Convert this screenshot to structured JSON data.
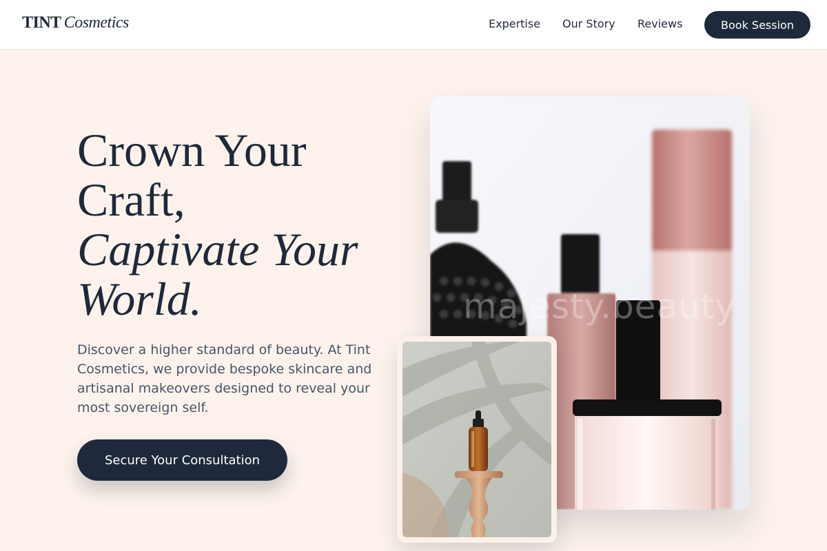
{
  "brand": {
    "name": "TINT",
    "sub": "Cosmetics"
  },
  "nav": {
    "links": [
      "Expertise",
      "Our Story",
      "Reviews"
    ],
    "cta": "Book Session"
  },
  "hero": {
    "title_line1": "Crown Your",
    "title_line2": "Craft,",
    "title_line3": "Captivate Your",
    "title_line4": "World.",
    "description": "Discover a higher standard of beauty. At Tint Cosmetics, we provide bespoke skincare and artisanal makeovers designed to reveal your most sovereign self.",
    "cta": "Secure Your Consultation"
  },
  "images": {
    "main_watermark": "majesty.beauty"
  },
  "colors": {
    "navy": "#1e293b",
    "background": "#fdf3ec",
    "body_text": "#475569",
    "rose": "#c58a86"
  }
}
